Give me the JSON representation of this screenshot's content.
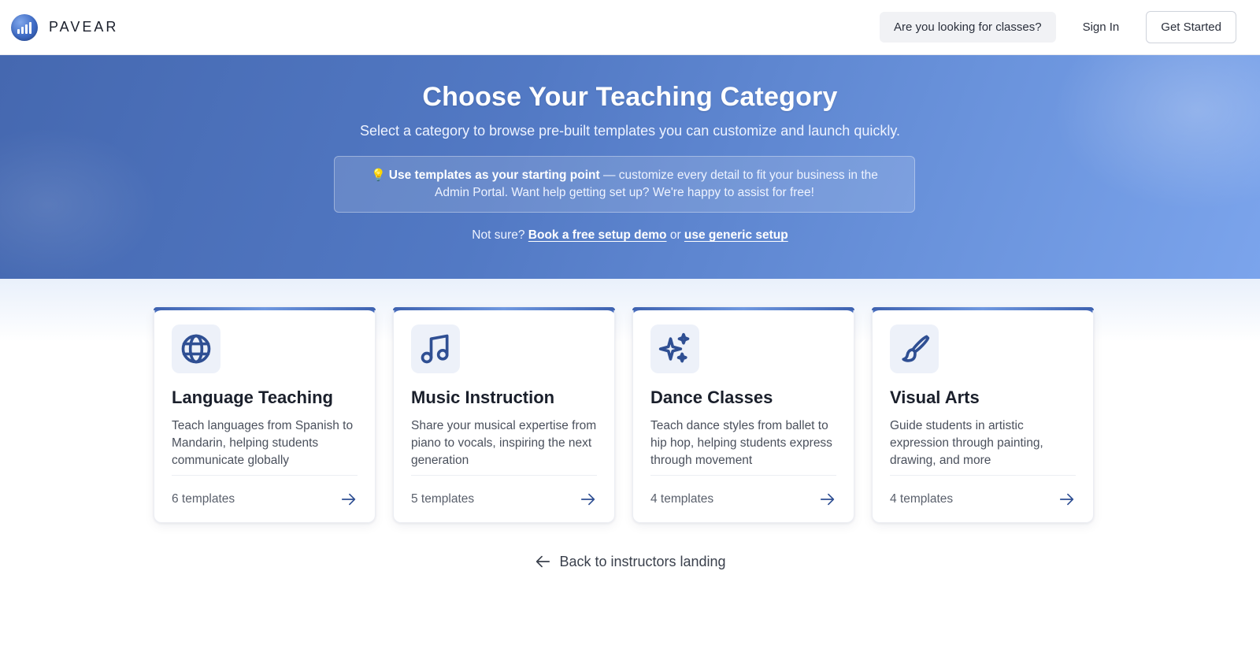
{
  "header": {
    "brand_name": "PAVEAR",
    "classes_button": "Are you looking for classes?",
    "signin_button": "Sign In",
    "get_started_button": "Get Started"
  },
  "hero": {
    "title": "Choose Your Teaching Category",
    "subtitle": "Select a category to browse pre-built templates you can customize and launch quickly.",
    "tip_bold": "Use templates as your starting point",
    "tip_rest": " — customize every detail to fit your business in the Admin Portal. Want help getting set up? We're happy to assist for free!",
    "links_prefix": "Not sure? ",
    "demo_link": "Book a free setup demo",
    "links_or": " or ",
    "generic_link": "use generic setup"
  },
  "cards": [
    {
      "icon": "globe-icon",
      "title": "Language Teaching",
      "description": "Teach languages from Spanish to Mandarin, helping students communicate globally",
      "count": "6 templates"
    },
    {
      "icon": "music-note-icon",
      "title": "Music Instruction",
      "description": "Share your musical expertise from piano to vocals, inspiring the next generation",
      "count": "5 templates"
    },
    {
      "icon": "sparkles-icon",
      "title": "Dance Classes",
      "description": "Teach dance styles from ballet to hip hop, helping students express through movement",
      "count": "4 templates"
    },
    {
      "icon": "paintbrush-icon",
      "title": "Visual Arts",
      "description": "Guide students in artistic expression through painting, drawing, and more",
      "count": "4 templates"
    }
  ],
  "footer": {
    "back_link": "Back to instructors landing"
  },
  "colors": {
    "accent": "#2f4f93",
    "hero_start": "#4568b0",
    "hero_end": "#7ba4ec"
  }
}
